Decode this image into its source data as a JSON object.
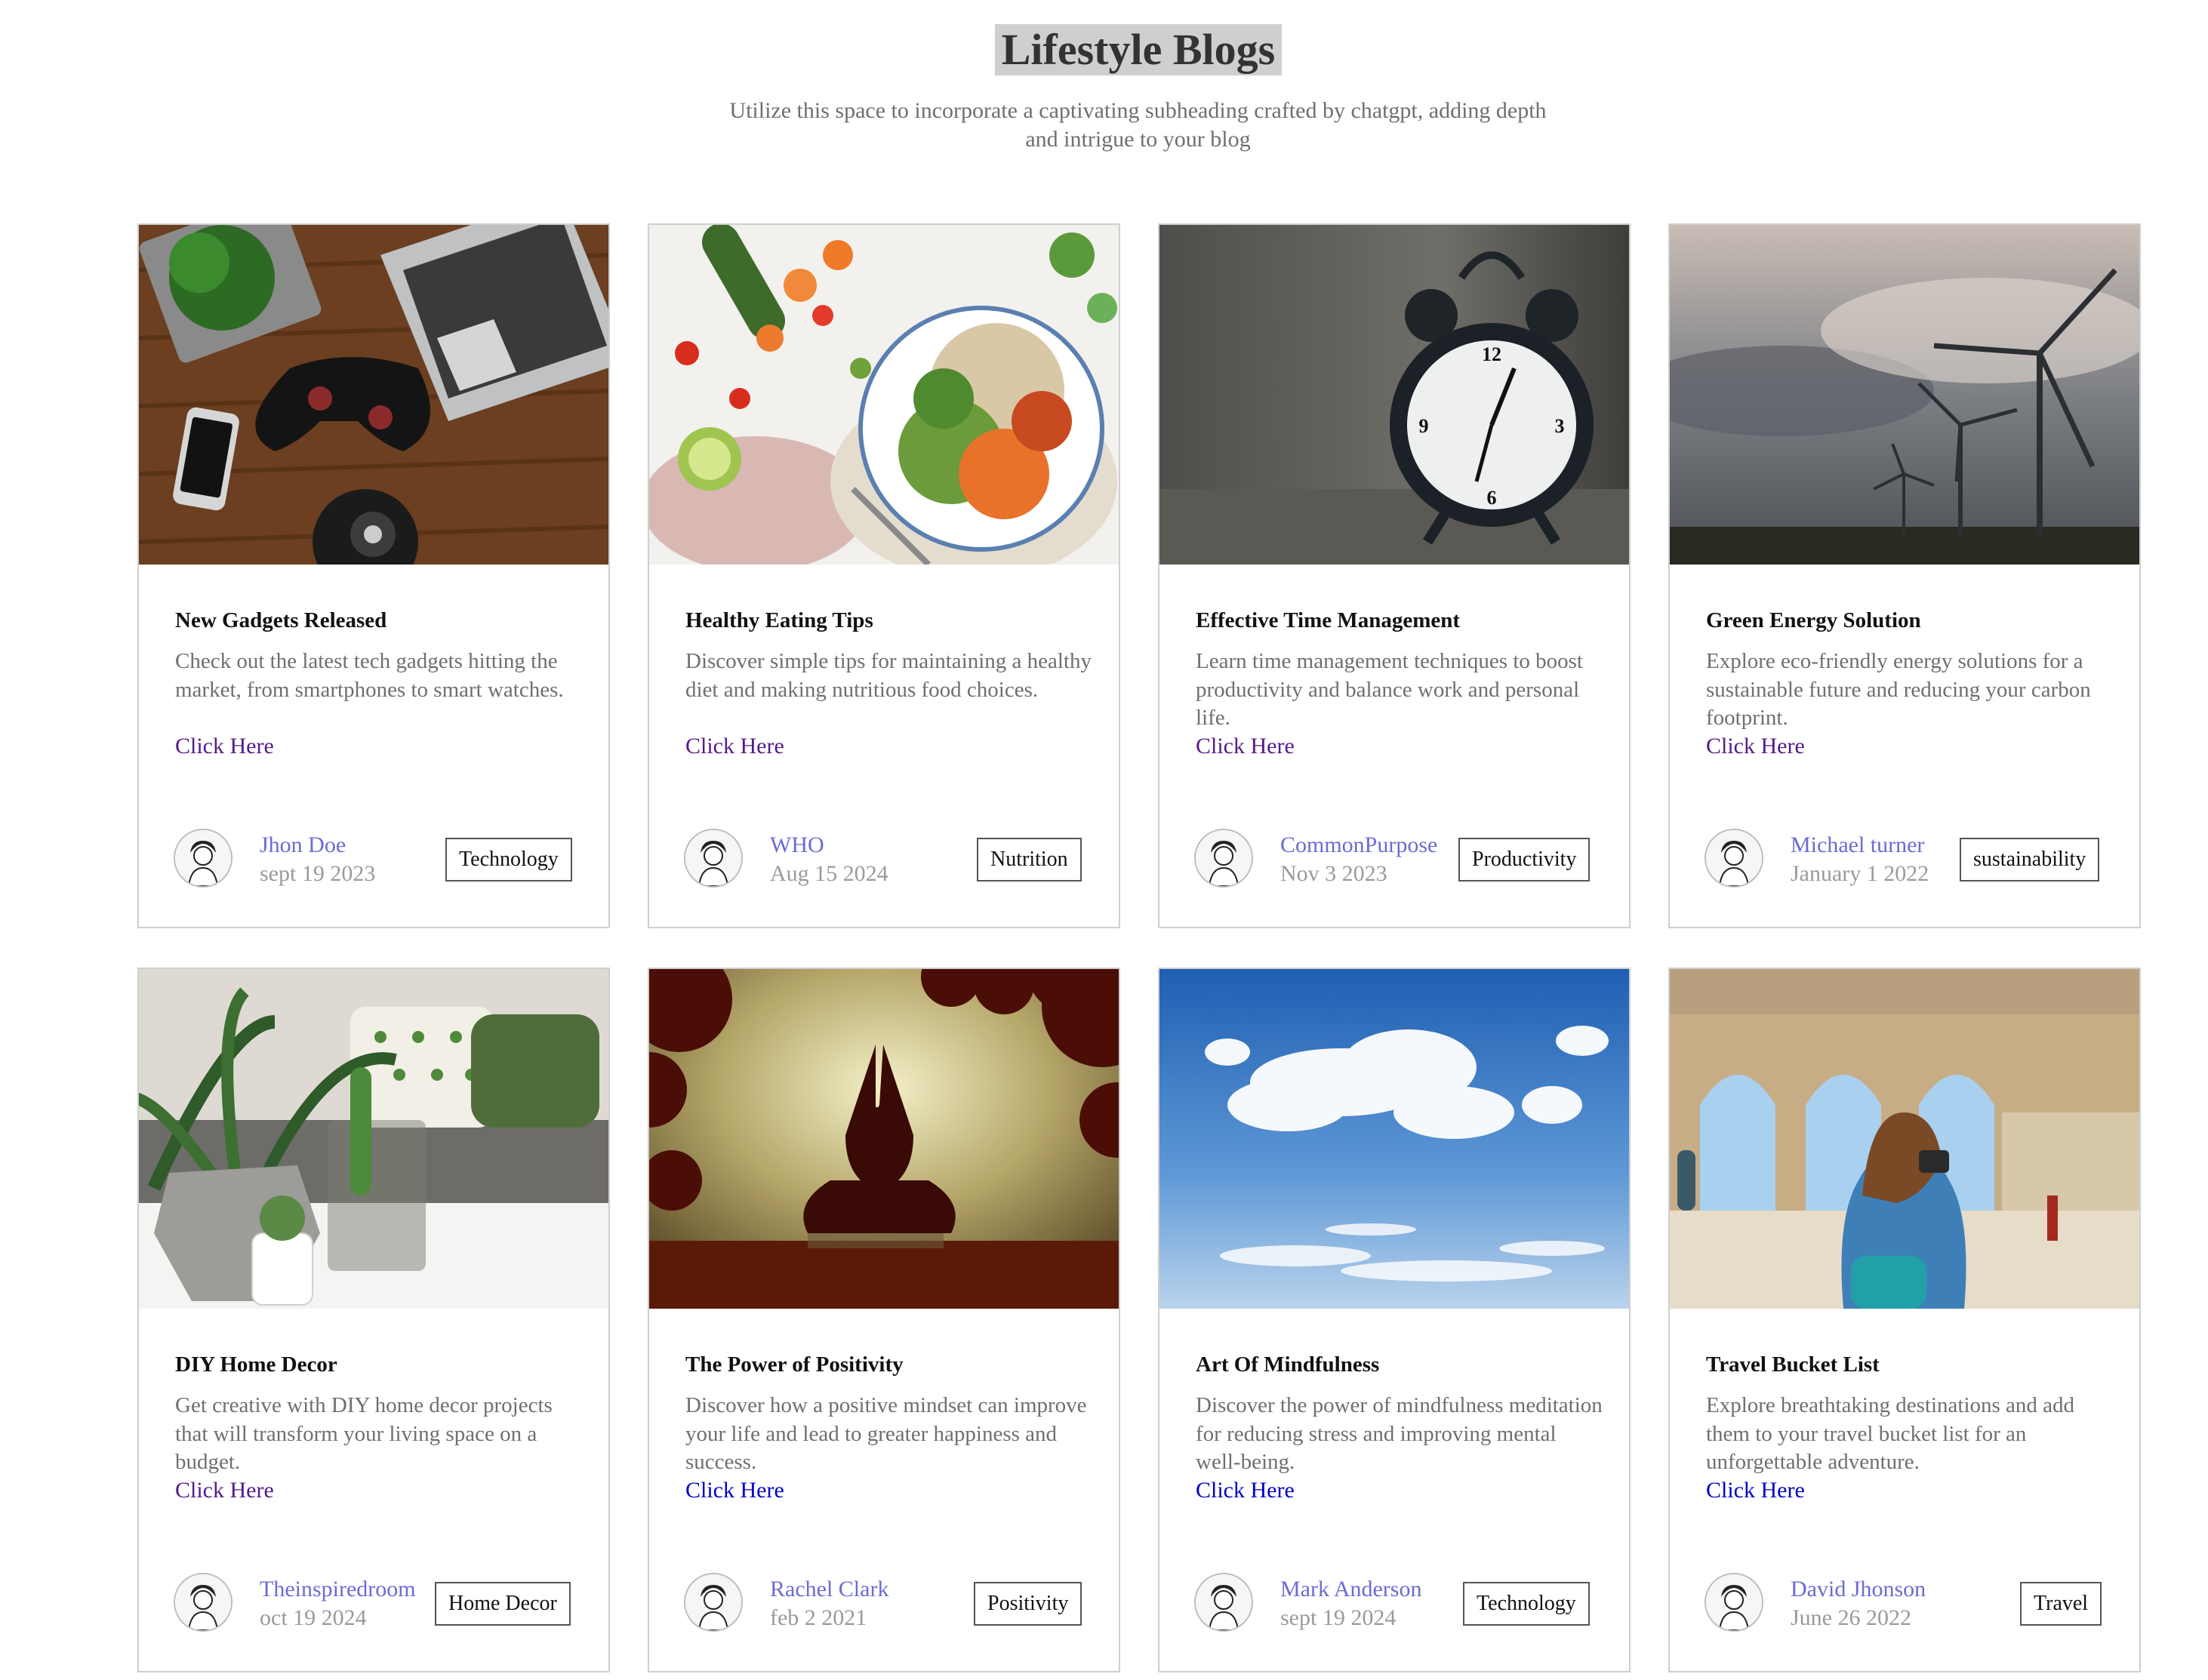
{
  "page": {
    "title": "Lifestyle Blogs",
    "subtitle": "Utilize this space to incorporate a captivating subheading crafted by chatgpt, adding depth and intrigue to your blog"
  },
  "cards": [
    {
      "image": "gadgets-desk-photo",
      "title": "New Gadgets Released",
      "description": "Check out the latest tech gadgets hitting the market, from smartphones to smart watches.",
      "link": "Click Here",
      "author": "Jhon Doe",
      "date": "sept 19 2023",
      "tag": "Technology"
    },
    {
      "image": "healthy-food-bowl-photo",
      "title": "Healthy Eating Tips",
      "description": "Discover simple tips for maintaining a healthy diet and making nutritious food choices.",
      "link": "Click Here",
      "author": "WHO",
      "date": "Aug 15 2024",
      "tag": "Nutrition"
    },
    {
      "image": "alarm-clock-photo",
      "title": "Effective Time Management",
      "description": "Learn time management techniques to boost productivity and balance work and personal life.",
      "link": "Click Here",
      "author": "CommonPurpose",
      "date": "Nov 3 2023",
      "tag": "Productivity"
    },
    {
      "image": "wind-turbines-photo",
      "title": "Green Energy Solution",
      "description": "Explore eco-friendly energy solutions for a sustainable future and reducing your carbon footprint.",
      "link": "Click Here",
      "author": "Michael turner",
      "date": "January 1 2022",
      "tag": "sustainability"
    },
    {
      "image": "home-decor-plants-photo",
      "title": "DIY Home Decor",
      "description": "Get creative with DIY home decor projects that will transform your living space on a budget.",
      "link": "Click Here",
      "author": "Theinspiredroom",
      "date": "oct 19 2024",
      "tag": "Home Decor"
    },
    {
      "image": "meditation-sunset-photo",
      "title": "The Power of Positivity",
      "description": "Discover how a positive mindset can improve your life and lead to greater happiness and success.",
      "link": "Click Here",
      "author": "Rachel Clark",
      "date": "feb 2 2021",
      "tag": "Positivity"
    },
    {
      "image": "clouds-sky-photo",
      "title": "Art Of Mindfulness",
      "description": "Discover the power of mindfulness meditation for reducing stress and improving mental well-being.",
      "link": "Click Here",
      "author": "Mark Anderson",
      "date": "sept 19 2024",
      "tag": "Technology"
    },
    {
      "image": "travel-arches-photo",
      "title": "Travel Bucket List",
      "description": "Explore breathtaking destinations and add them to your travel bucket list for an unforgettable adventure.",
      "link": "Click Here",
      "author": "David Jhonson",
      "date": "June 26 2022",
      "tag": "Travel"
    }
  ],
  "colors": {
    "title_highlight": "#cfcfcf",
    "author": "#6b6bd6",
    "date": "#9a9a9a",
    "visited_link": "#551a8b",
    "link": "#0000cc"
  }
}
